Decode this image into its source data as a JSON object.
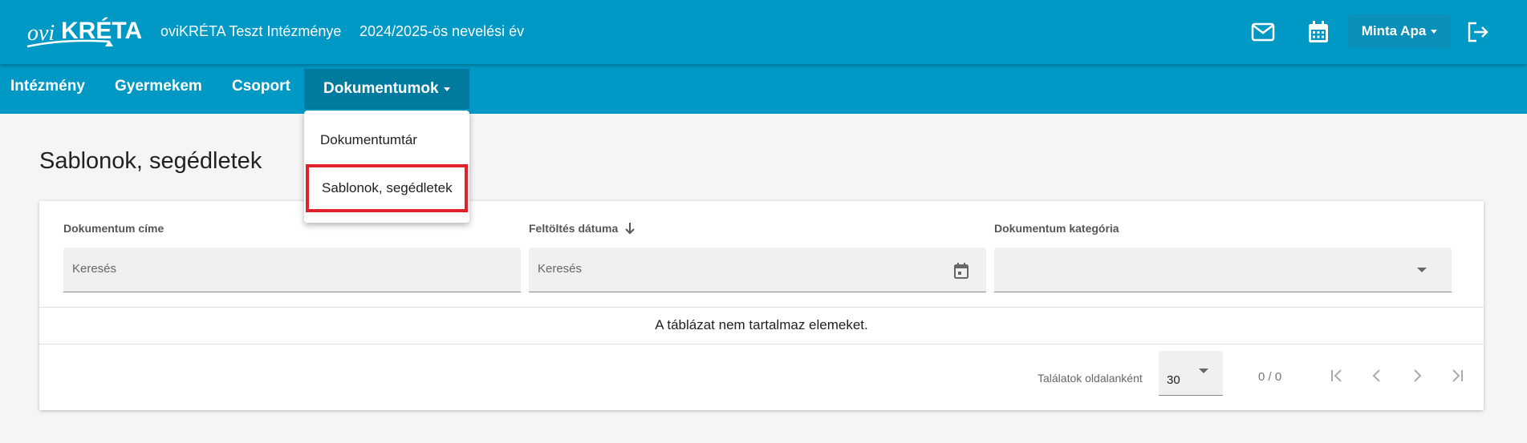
{
  "header": {
    "logo_text": "oviKRÉTA",
    "institution": "oviKRÉTA Teszt Intézménye",
    "school_year": "2024/2025-ös nevelési év",
    "icons": [
      "mail-icon",
      "calendar-icon",
      "logout-icon"
    ],
    "user_name": "Minta Apa",
    "colors": {
      "bar": "#0098c4",
      "active_tab": "#007a9e",
      "highlight": "#e0202a"
    }
  },
  "nav": {
    "items": [
      {
        "label": "Intézmény"
      },
      {
        "label": "Gyermekem"
      },
      {
        "label": "Csoport"
      },
      {
        "label": "Dokumentumok"
      }
    ],
    "dropdown": [
      {
        "label": "Dokumentumtár"
      },
      {
        "label": "Sablonok, segédletek"
      }
    ]
  },
  "page": {
    "title": "Sablonok, segédletek"
  },
  "table": {
    "columns": [
      {
        "label": "Dokumentum címe",
        "placeholder": "Keresés"
      },
      {
        "label": "Feltöltés dátuma",
        "placeholder": "Keresés",
        "sort_icon": "arrow-down-icon"
      },
      {
        "label": "Dokumentum kategória",
        "placeholder": ""
      }
    ],
    "empty_message": "A táblázat nem tartalmaz elemeket.",
    "pagination": {
      "per_page_label": "Találatok oldalanként",
      "per_page_value": "30",
      "range": "0 / 0"
    }
  }
}
